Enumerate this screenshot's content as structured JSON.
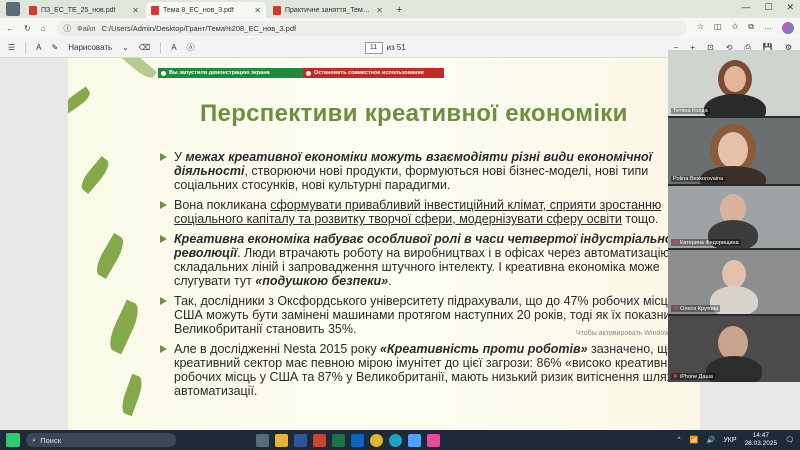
{
  "tabs": [
    {
      "label": "ПЗ_ЕС_ТЕ_25_нов.pdf",
      "active": false
    },
    {
      "label": "Тема 8_ЕС_нов_3.pdf",
      "active": true
    },
    {
      "label": "Практичне заняття_Тема 5_Фін",
      "active": false
    }
  ],
  "address": {
    "file_label": "Файл",
    "url": "C:/Users/Admin/Desktop/Грант/Тема%208_ЕС_нов_3.pdf"
  },
  "pdf_toolbar": {
    "draw_label": "Нарисовать",
    "page_current": "11",
    "page_total": "из 51"
  },
  "share_bar": {
    "sharing_text": "Вы запустили демонстрацию экрана",
    "stop_text": "Остановить совместное использование"
  },
  "slide": {
    "title": "Перспективи креативної економіки",
    "bullets": [
      {
        "parts": [
          {
            "t": "У ",
            "s": ""
          },
          {
            "t": "межах креативної економіки можуть взаємодіяти різні види економічної діяльності",
            "s": "bi"
          },
          {
            "t": ", створюючи нові продукти, формуються нові бізнес-моделі, нові типи соціальних стосунків, нові культурні парадигми.",
            "s": ""
          }
        ]
      },
      {
        "parts": [
          {
            "t": "Вона покликана ",
            "s": ""
          },
          {
            "t": "сформувати привабливий інвестиційний клімат, сприяти зростанню соціального капіталу та розвитку творчої сфери, модернізувати сферу освіти",
            "s": "u"
          },
          {
            "t": " тощо.",
            "s": ""
          }
        ]
      },
      {
        "parts": [
          {
            "t": "Креативна економіка набуває особливої ролі в часи четвертої індустріальної революції",
            "s": "bi"
          },
          {
            "t": ". Люди втрачають роботу на виробництвах і в офісах через автоматизацію складальних ліній і запровадження штучного інтелекту. І креативна економіка може слугувати тут ",
            "s": ""
          },
          {
            "t": "«подушкою безпеки»",
            "s": "bi"
          },
          {
            "t": ".",
            "s": ""
          }
        ]
      },
      {
        "parts": [
          {
            "t": "Так, дослідники з Оксфордського університету підрахували, що до 47% робочих місць у США можуть бути замінені машинами протягом наступних 20 років, тоді як їх показник для Великобританії становить 35%.",
            "s": ""
          }
        ]
      },
      {
        "parts": [
          {
            "t": "Але в дослідженні Nesta 2015 року ",
            "s": ""
          },
          {
            "t": "«Креативність проти роботів»",
            "s": "bi"
          },
          {
            "t": " зазначено, що креативний сектор має певною мірою імунітет до цієї загрози: 86% «високо креативних» робочих місць у США та 87% у Великобританії, мають низький ризик витіснення шляхом автоматизації.",
            "s": ""
          }
        ]
      }
    ]
  },
  "watermark": "Чтобы активировать Windows, перейдите в раздел",
  "participants": [
    {
      "name": "Тетяна Колда",
      "muted": false
    },
    {
      "name": "Polina Beskorovaina",
      "muted": false
    },
    {
      "name": "Катерина Федорищина",
      "muted": true
    },
    {
      "name": "Олеся Крутова",
      "muted": true
    },
    {
      "name": "iPhone Даша",
      "muted": true
    }
  ],
  "taskbar": {
    "search_label": "Поиск",
    "lang": "УКР",
    "time": "14:47",
    "date": "28.03.2025"
  },
  "colors": {
    "title_green": "#6e8f3f",
    "share_green": "#1f8a3c",
    "share_red": "#c02a2a",
    "taskbar_bg": "#1c2a3a"
  }
}
